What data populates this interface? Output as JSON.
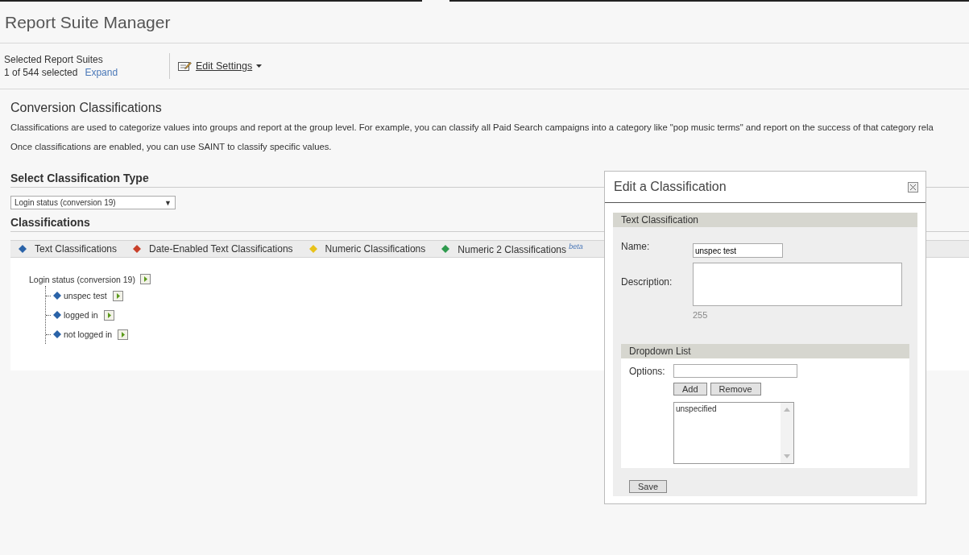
{
  "header": {
    "title": "Report Suite Manager"
  },
  "selection": {
    "label": "Selected Report Suites",
    "count": "1 of 544 selected",
    "expand": "Expand",
    "edit_settings": "Edit Settings"
  },
  "section": {
    "title": "Conversion Classifications",
    "paragraphs": [
      "Classifications are used to categorize values into groups and report at the group level. For example, you can classify all Paid Search campaigns into a category like \"pop music terms\" and report on the success of that category rela",
      "Once classifications are enabled, you can use SAINT to classify specific values."
    ]
  },
  "type_select": {
    "heading": "Select Classification Type",
    "value": "Login status (conversion 19)",
    "arrow": "▼"
  },
  "classifications": {
    "heading": "Classifications",
    "legend": [
      {
        "label": "Text Classifications",
        "color": "#2a63a8"
      },
      {
        "label": "Date-Enabled Text Classifications",
        "color": "#c9402a"
      },
      {
        "label": "Numeric Classifications",
        "color": "#e8c21a"
      },
      {
        "label": "Numeric 2 Classifications $^{beta}$",
        "color": "#2f9a4e"
      }
    ],
    "tree": {
      "label": "Login status (conversion 19)",
      "children": [
        {
          "label": "unspec test"
        },
        {
          "label": "logged in"
        },
        {
          "label": "not logged in"
        }
      ]
    }
  },
  "dialog": {
    "title": "Edit a Classification",
    "section_title": "Text Classification",
    "name_label": "Name:",
    "name_value": "unspec test",
    "description_label": "Description:",
    "char_count": "255",
    "dropdown_title": "Dropdown List",
    "options_label": "Options:",
    "add": "Add",
    "remove": "Remove",
    "options": [
      "unspecified"
    ],
    "save": "Save"
  }
}
